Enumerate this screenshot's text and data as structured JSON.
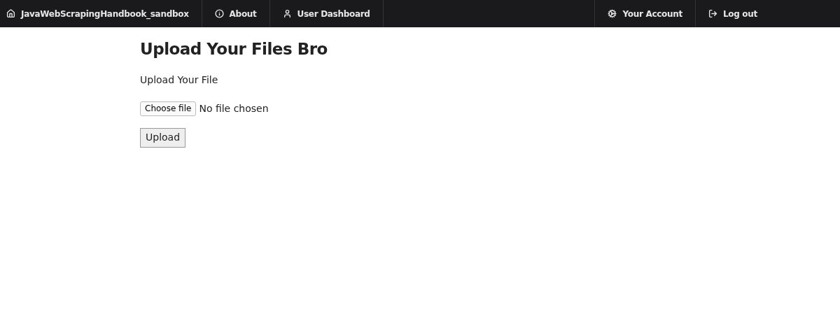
{
  "navbar": {
    "left": [
      {
        "label": "JavaWebScrapingHandbook_sandbox"
      },
      {
        "label": "About"
      },
      {
        "label": "User Dashboard"
      }
    ],
    "right": [
      {
        "label": "Your Account"
      },
      {
        "label": "Log out"
      }
    ]
  },
  "page": {
    "title": "Upload Your Files Bro",
    "label": "Upload Your File",
    "file_button": "Choose file",
    "file_status": "No file chosen",
    "submit": "Upload"
  }
}
